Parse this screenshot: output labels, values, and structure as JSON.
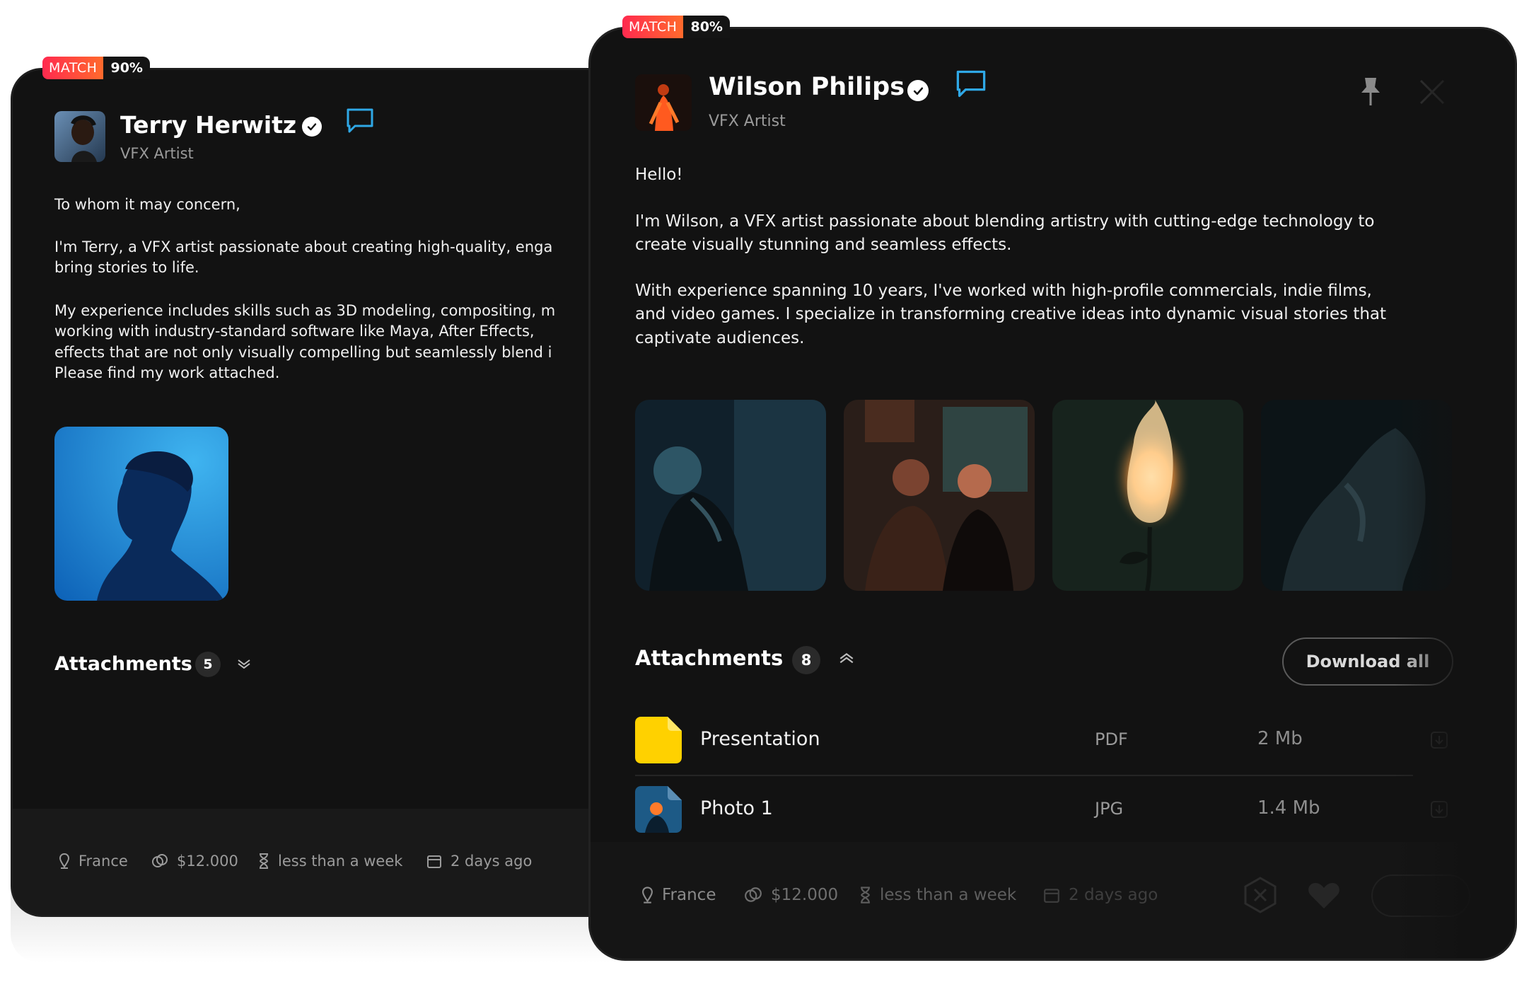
{
  "terry": {
    "match_label": "MATCH",
    "match_percent": "90%",
    "name": "Terry Herwitz",
    "role": "VFX Artist",
    "greeting": "To whom it may concern,",
    "paragraph1": "I'm Terry, a VFX artist passionate about creating high-quality, enga",
    "paragraph1_line2": "bring stories to life.",
    "paragraph2_lines": [
      "My experience includes skills such as 3D modeling, compositing, m",
      "working with industry-standard software like Maya, After Effects,",
      "effects that are not only visually compelling but seamlessly blend i",
      "Please find my work attached."
    ],
    "attachments_label": "Attachments",
    "attachments_count": "5",
    "meta": {
      "location": "France",
      "budget": "$12.000",
      "duration": "less than a week",
      "posted": "2 days ago"
    }
  },
  "wilson": {
    "match_label": "MATCH",
    "match_percent": "80%",
    "name": "Wilson Philips",
    "role": "VFX Artist",
    "greeting": "Hello!",
    "paragraph1_lines": [
      "I'm Wilson, a VFX artist passionate about blending artistry with cutting-edge technology to",
      "create visually stunning and seamless effects."
    ],
    "paragraph2_lines": [
      "With experience spanning 10 years, I've worked with high-profile commercials, indie films,",
      "and video games. I specialize in transforming creative ideas into dynamic visual stories that",
      "captivate audiences."
    ],
    "attachments_label": "Attachments",
    "attachments_count": "8",
    "download_all_label": "Download all",
    "files": [
      {
        "name": "Presentation",
        "type": "PDF",
        "size": "2 Mb"
      },
      {
        "name": "Photo 1",
        "type": "JPG",
        "size": "1.4 Mb"
      }
    ],
    "meta": {
      "location": "France",
      "budget": "$12.000",
      "duration": "less than a week",
      "posted": "2 days ago"
    }
  },
  "colors": {
    "match_gradient_start": "#ff2a4f",
    "match_gradient_end": "#ff6a2c",
    "chat_icon": "#2fa8e6",
    "card_bg": "#121212",
    "pdf_yellow": "#ffd100"
  }
}
